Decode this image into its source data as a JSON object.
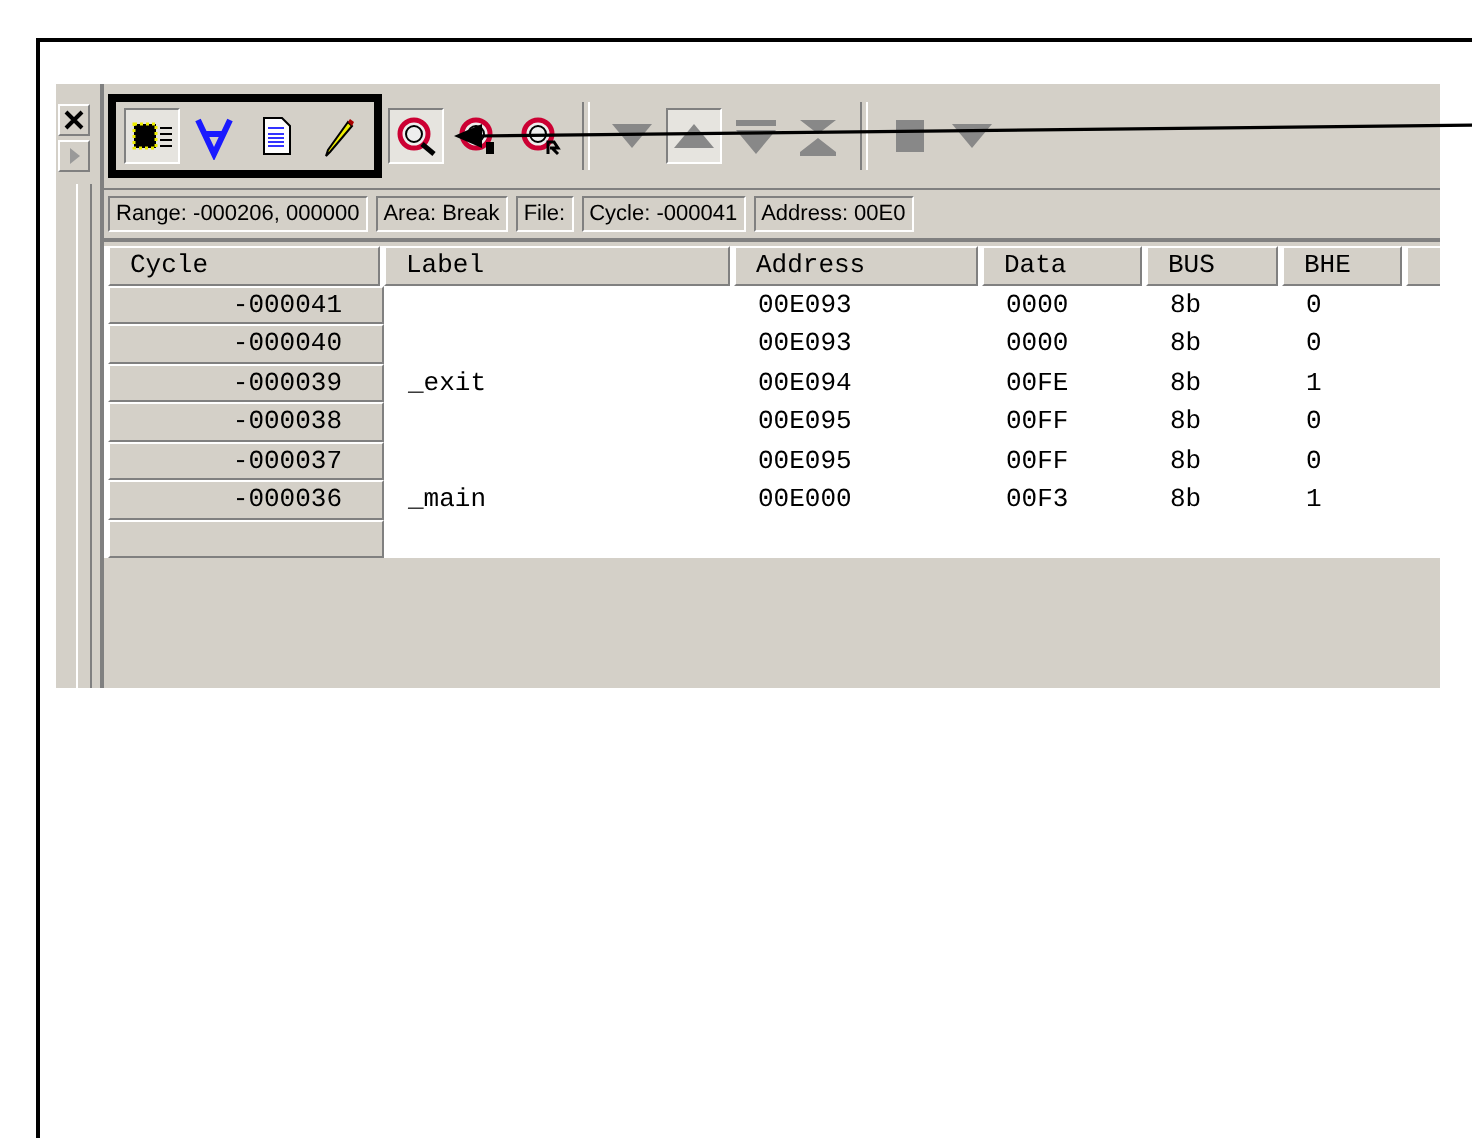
{
  "toolbar": {
    "highlighted_group": {
      "buttons": [
        {
          "kind": "chip",
          "pressed": true
        },
        {
          "kind": "forall",
          "pressed": false
        },
        {
          "kind": "document",
          "pressed": false
        },
        {
          "kind": "pencil",
          "pressed": false
        }
      ]
    },
    "groups": [
      {
        "buttons": [
          {
            "kind": "search-a",
            "pressed": true
          },
          {
            "kind": "search-b",
            "pressed": false
          },
          {
            "kind": "search-r",
            "pressed": false
          }
        ]
      },
      {
        "buttons": [
          {
            "kind": "down",
            "pressed": false
          },
          {
            "kind": "up",
            "pressed": true
          },
          {
            "kind": "down-bar",
            "pressed": false
          },
          {
            "kind": "bottom",
            "pressed": false
          }
        ]
      },
      {
        "buttons": [
          {
            "kind": "stop",
            "pressed": false
          },
          {
            "kind": "down",
            "pressed": false
          }
        ]
      }
    ]
  },
  "status_fields": [
    "Range: -000206,  000000",
    "Area: Break",
    "File:",
    "Cycle: -000041",
    "Address: 00E0"
  ],
  "table": {
    "columns": [
      "Cycle",
      "Label",
      "Address",
      "Data",
      "BUS",
      "BHE"
    ],
    "rows": [
      {
        "cycle": "-000041",
        "label": "",
        "address": "00E093",
        "data": "0000",
        "bus": "8b",
        "bhe": "0"
      },
      {
        "cycle": "-000040",
        "label": "",
        "address": "00E093",
        "data": "0000",
        "bus": "8b",
        "bhe": "0"
      },
      {
        "cycle": "-000039",
        "label": "_exit",
        "address": "00E094",
        "data": "00FE",
        "bus": "8b",
        "bhe": "1"
      },
      {
        "cycle": "-000038",
        "label": "",
        "address": "00E095",
        "data": "00FF",
        "bus": "8b",
        "bhe": "0"
      },
      {
        "cycle": "-000037",
        "label": "",
        "address": "00E095",
        "data": "00FF",
        "bus": "8b",
        "bhe": "0"
      },
      {
        "cycle": "-000036",
        "label": "_main",
        "address": "00E000",
        "data": "00F3",
        "bus": "8b",
        "bhe": "1"
      }
    ]
  }
}
